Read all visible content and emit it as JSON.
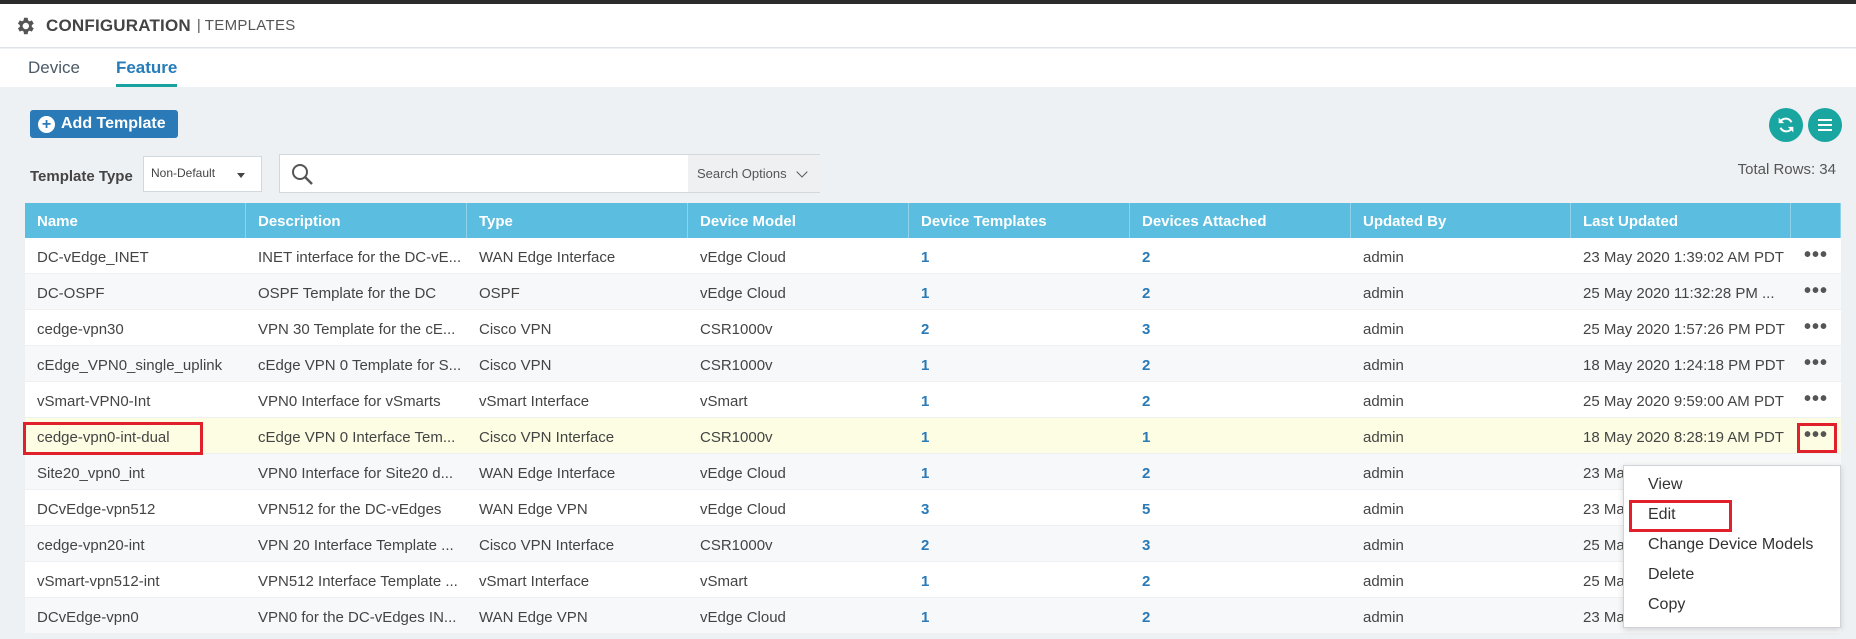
{
  "header": {
    "title": "CONFIGURATION",
    "separator": "|",
    "subtitle": "TEMPLATES"
  },
  "tabs": [
    {
      "label": "Device"
    },
    {
      "label": "Feature"
    }
  ],
  "toolbar": {
    "add_label": "Add Template"
  },
  "filter": {
    "label": "Template Type",
    "value": "Non-Default"
  },
  "search": {
    "placeholder": "",
    "options_label": "Search Options"
  },
  "total_rows": "Total Rows: 34",
  "table": {
    "columns": [
      "Name",
      "Description",
      "Type",
      "Device Model",
      "Device Templates",
      "Devices Attached",
      "Updated By",
      "Last Updated"
    ],
    "rows": [
      {
        "name": "DC-vEdge_INET",
        "description": "INET interface for the DC-vE...",
        "type": "WAN Edge Interface",
        "model": "vEdge Cloud",
        "templates": "1",
        "attached": "2",
        "updated_by": "admin",
        "last_updated": "23 May 2020 1:39:02 AM PDT"
      },
      {
        "name": "DC-OSPF",
        "description": "OSPF Template for the DC",
        "type": "OSPF",
        "model": "vEdge Cloud",
        "templates": "1",
        "attached": "2",
        "updated_by": "admin",
        "last_updated": "25 May 2020 11:32:28 PM ..."
      },
      {
        "name": "cedge-vpn30",
        "description": "VPN 30 Template for the cE...",
        "type": "Cisco VPN",
        "model": "CSR1000v",
        "templates": "2",
        "attached": "3",
        "updated_by": "admin",
        "last_updated": "25 May 2020 1:57:26 PM PDT"
      },
      {
        "name": "cEdge_VPN0_single_uplink",
        "description": "cEdge VPN 0 Template for S...",
        "type": "Cisco VPN",
        "model": "CSR1000v",
        "templates": "1",
        "attached": "2",
        "updated_by": "admin",
        "last_updated": "18 May 2020 1:24:18 PM PDT"
      },
      {
        "name": "vSmart-VPN0-Int",
        "description": "VPN0 Interface for vSmarts",
        "type": "vSmart Interface",
        "model": "vSmart",
        "templates": "1",
        "attached": "2",
        "updated_by": "admin",
        "last_updated": "25 May 2020 9:59:00 AM PDT"
      },
      {
        "name": "cedge-vpn0-int-dual",
        "description": "cEdge VPN 0 Interface Tem...",
        "type": "Cisco VPN Interface",
        "model": "CSR1000v",
        "templates": "1",
        "attached": "1",
        "updated_by": "admin",
        "last_updated": "18 May 2020 8:28:19 AM PDT"
      },
      {
        "name": "Site20_vpn0_int",
        "description": "VPN0 Interface for Site20 d...",
        "type": "WAN Edge Interface",
        "model": "vEdge Cloud",
        "templates": "1",
        "attached": "2",
        "updated_by": "admin",
        "last_updated": "23 Ma"
      },
      {
        "name": "DCvEdge-vpn512",
        "description": "VPN512 for the DC-vEdges",
        "type": "WAN Edge VPN",
        "model": "vEdge Cloud",
        "templates": "3",
        "attached": "5",
        "updated_by": "admin",
        "last_updated": "23 Ma"
      },
      {
        "name": "cedge-vpn20-int",
        "description": "VPN 20 Interface Template ...",
        "type": "Cisco VPN Interface",
        "model": "CSR1000v",
        "templates": "2",
        "attached": "3",
        "updated_by": "admin",
        "last_updated": "25 Ma"
      },
      {
        "name": "vSmart-vpn512-int",
        "description": "VPN512 Interface Template ...",
        "type": "vSmart Interface",
        "model": "vSmart",
        "templates": "1",
        "attached": "2",
        "updated_by": "admin",
        "last_updated": "25 Ma"
      },
      {
        "name": "DCvEdge-vpn0",
        "description": "VPN0 for the DC-vEdges IN...",
        "type": "WAN Edge VPN",
        "model": "vEdge Cloud",
        "templates": "1",
        "attached": "2",
        "updated_by": "admin",
        "last_updated": "23 Ma"
      }
    ],
    "row_action": "•••"
  },
  "context_menu": {
    "items": [
      "View",
      "Edit",
      "Change Device Models",
      "Delete",
      "Copy"
    ]
  },
  "icons": {
    "header": "gear-icon",
    "refresh": "refresh-icon",
    "menu": "hamburger-menu-icon",
    "search": "search-icon"
  },
  "colors": {
    "accent": "#2a7ab8",
    "teal": "#19a6a1",
    "table_header": "#5bbde0",
    "highlight_row": "#fdfde3",
    "annotation": "#e0202a"
  }
}
